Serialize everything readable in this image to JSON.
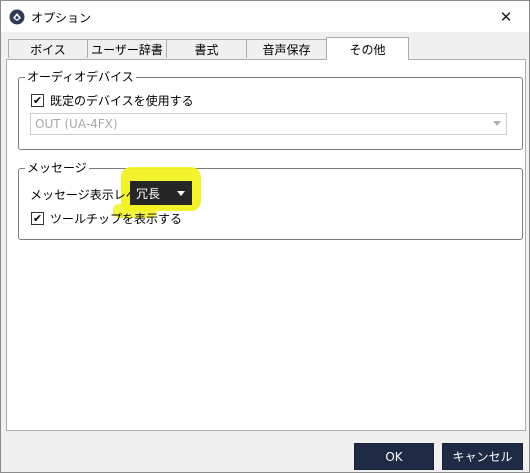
{
  "window": {
    "title": "オプション",
    "close_glyph": "✕"
  },
  "tabs": [
    {
      "label": "ボイス",
      "active": false
    },
    {
      "label": "ユーザー辞書",
      "active": false
    },
    {
      "label": "書式",
      "active": false
    },
    {
      "label": "音声保存",
      "active": false
    },
    {
      "label": "その他",
      "active": true
    }
  ],
  "audio_device": {
    "group_label": "オーディオデバイス",
    "use_default_label": "既定のデバイスを使用する",
    "use_default_checked": true,
    "device_value": "OUT (UA-4FX)",
    "device_enabled": false
  },
  "message": {
    "group_label": "メッセージ",
    "level_label": "メッセージ表示レベル",
    "level_value": "冗長",
    "tooltip_label": "ツールチップを表示する",
    "tooltip_checked": true,
    "highlight_color": "#f2f222"
  },
  "buttons": {
    "ok": "OK",
    "cancel": "キャンセル"
  },
  "icons": {
    "app": "app-logo-icon",
    "check": "✔"
  },
  "colors": {
    "button_bg": "#1f2a44",
    "dropdown_bg": "#262626"
  }
}
